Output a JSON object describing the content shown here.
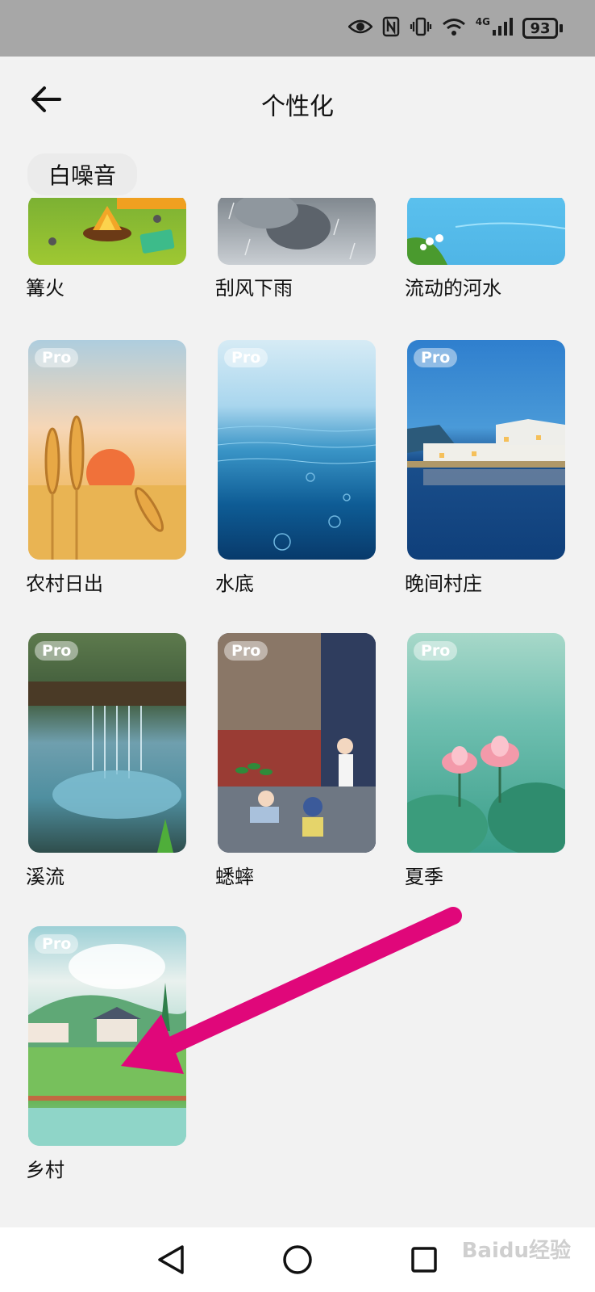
{
  "status_bar": {
    "battery": "93",
    "network": "4G"
  },
  "header": {
    "title": "个性化"
  },
  "section": {
    "label": "白噪音"
  },
  "grid": {
    "pro_label": "Pro",
    "items": [
      {
        "label": "篝火",
        "pro": false
      },
      {
        "label": "刮风下雨",
        "pro": false
      },
      {
        "label": "流动的河水",
        "pro": false
      },
      {
        "label": "农村日出",
        "pro": true
      },
      {
        "label": "水底",
        "pro": true
      },
      {
        "label": "晚间村庄",
        "pro": true
      },
      {
        "label": "溪流",
        "pro": true
      },
      {
        "label": "蟋蟀",
        "pro": true
      },
      {
        "label": "夏季",
        "pro": true
      },
      {
        "label": "乡村",
        "pro": true
      }
    ]
  },
  "icons": {
    "back": "back-arrow-icon",
    "nav_back": "triangle-back-icon",
    "nav_home": "circle-home-icon",
    "nav_recents": "square-recents-icon"
  },
  "annotation": {
    "arrow_color": "#e0077a"
  },
  "watermark": "Baidu经验"
}
